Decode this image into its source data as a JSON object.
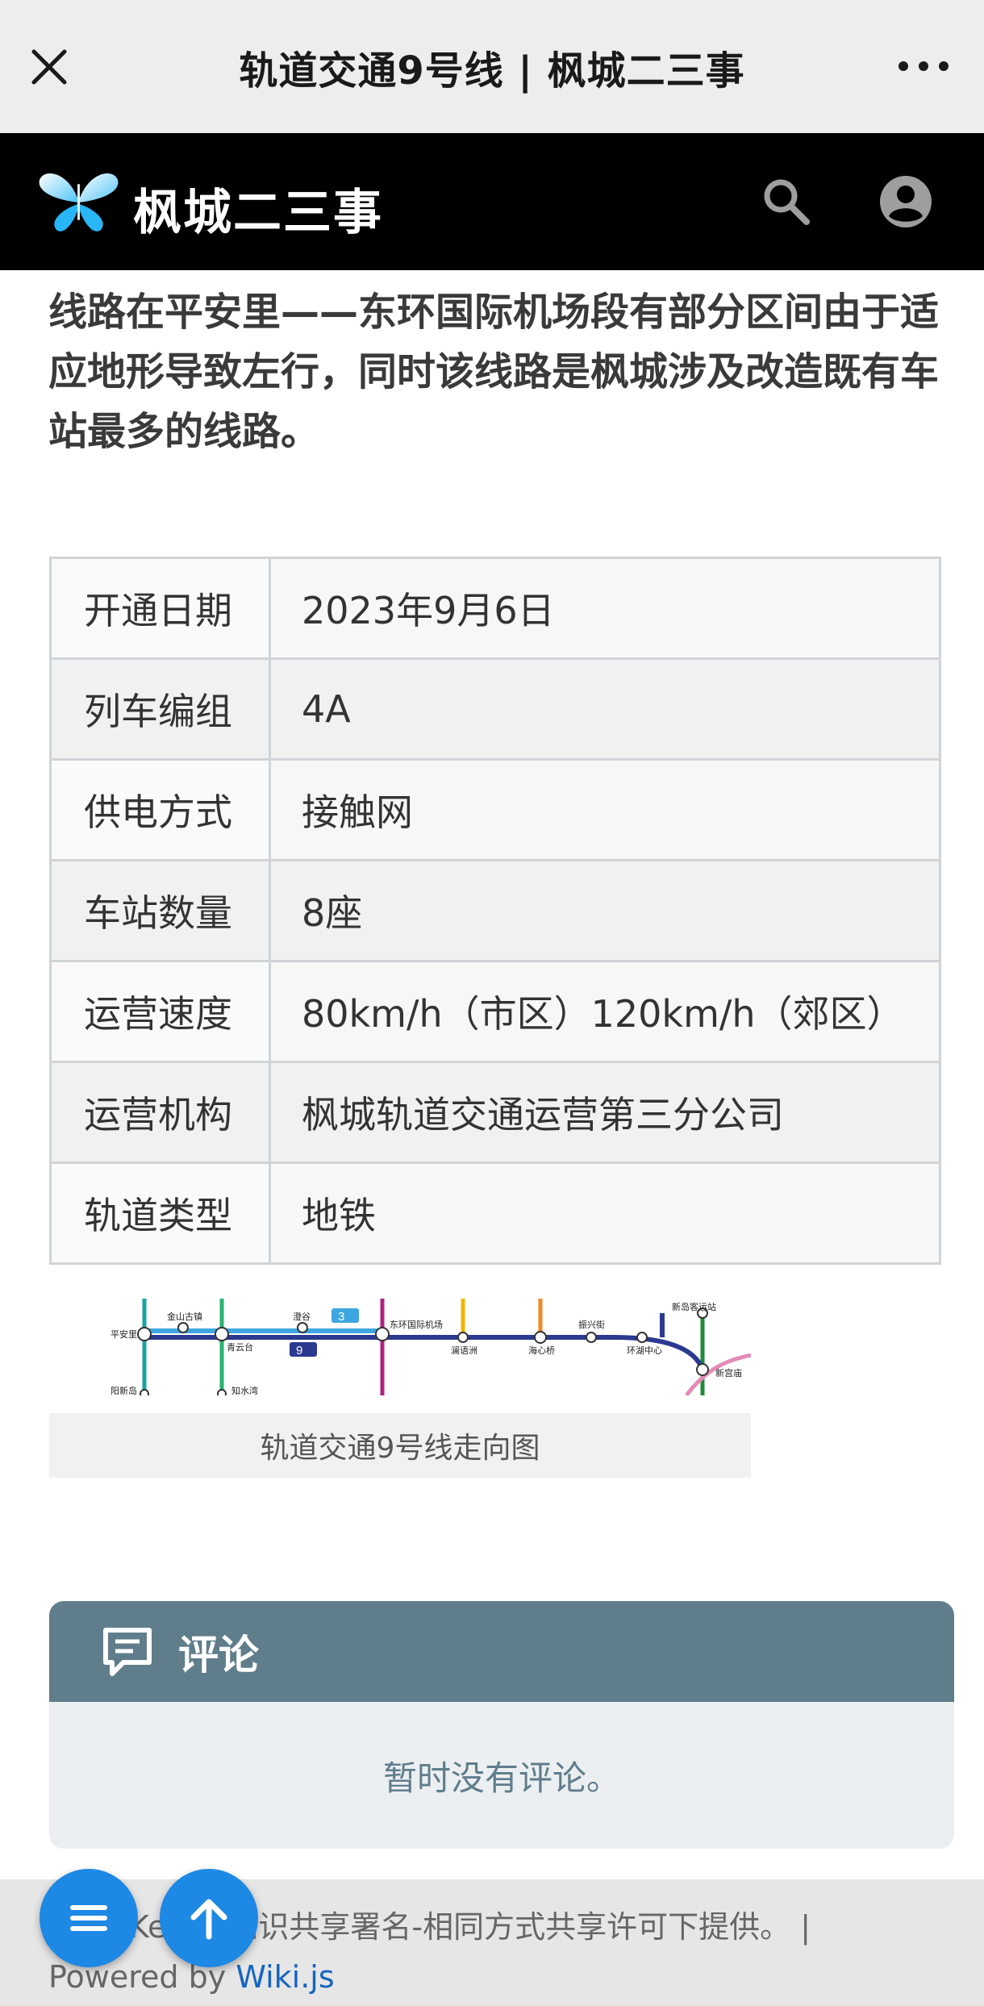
{
  "browser": {
    "title": "轨道交通9号线 | 枫城二三事"
  },
  "site": {
    "name": "枫城二三事"
  },
  "article": {
    "intro": "线路在平安里——东环国际机场段有部分区间由于适应地形导致左行，同时该线路是枫城涉及改造既有车站最多的线路。",
    "info_rows": [
      {
        "key": "开通日期",
        "value": "2023年9月6日"
      },
      {
        "key": "列车编组",
        "value": "4A"
      },
      {
        "key": "供电方式",
        "value": "接触网"
      },
      {
        "key": "车站数量",
        "value": "8座"
      },
      {
        "key": "运营速度",
        "value": "80km/h（市区）120km/h（郊区）"
      },
      {
        "key": "运营机构",
        "value": "枫城轨道交通运营第三分公司"
      },
      {
        "key": "轨道类型",
        "value": "地铁"
      }
    ],
    "map": {
      "caption": "轨道交通9号线走向图",
      "stations": [
        "平安里",
        "金山古镇",
        "青云台",
        "澄谷",
        "东环国际机场",
        "澜语洲",
        "海心桥",
        "振兴街",
        "环湖中心",
        "新岛客运站",
        "新宫庙",
        "阳新岛",
        "知水湾"
      ],
      "line_badges": [
        "3",
        "9"
      ],
      "colors": {
        "line9": "#2b3990",
        "line3": "#3ea6e0",
        "teal": "#1aa3a3",
        "green": "#2bb26e",
        "magenta": "#b1237f",
        "yellow": "#f4b400",
        "orange": "#f08a24",
        "darkgreen": "#1f8b3a",
        "pink": "#e48bb6"
      }
    }
  },
  "comments": {
    "header": "评论",
    "empty": "暂时没有评论。"
  },
  "footer": {
    "license": "Ke…在知识共享署名-相同方式共享许可下提供。 |",
    "powered_prefix": "Powered by ",
    "powered_link": "Wiki.js"
  },
  "colors": {
    "header_bg": "#000000",
    "comments_header": "#607d8b",
    "fab": "#1e88e5"
  }
}
